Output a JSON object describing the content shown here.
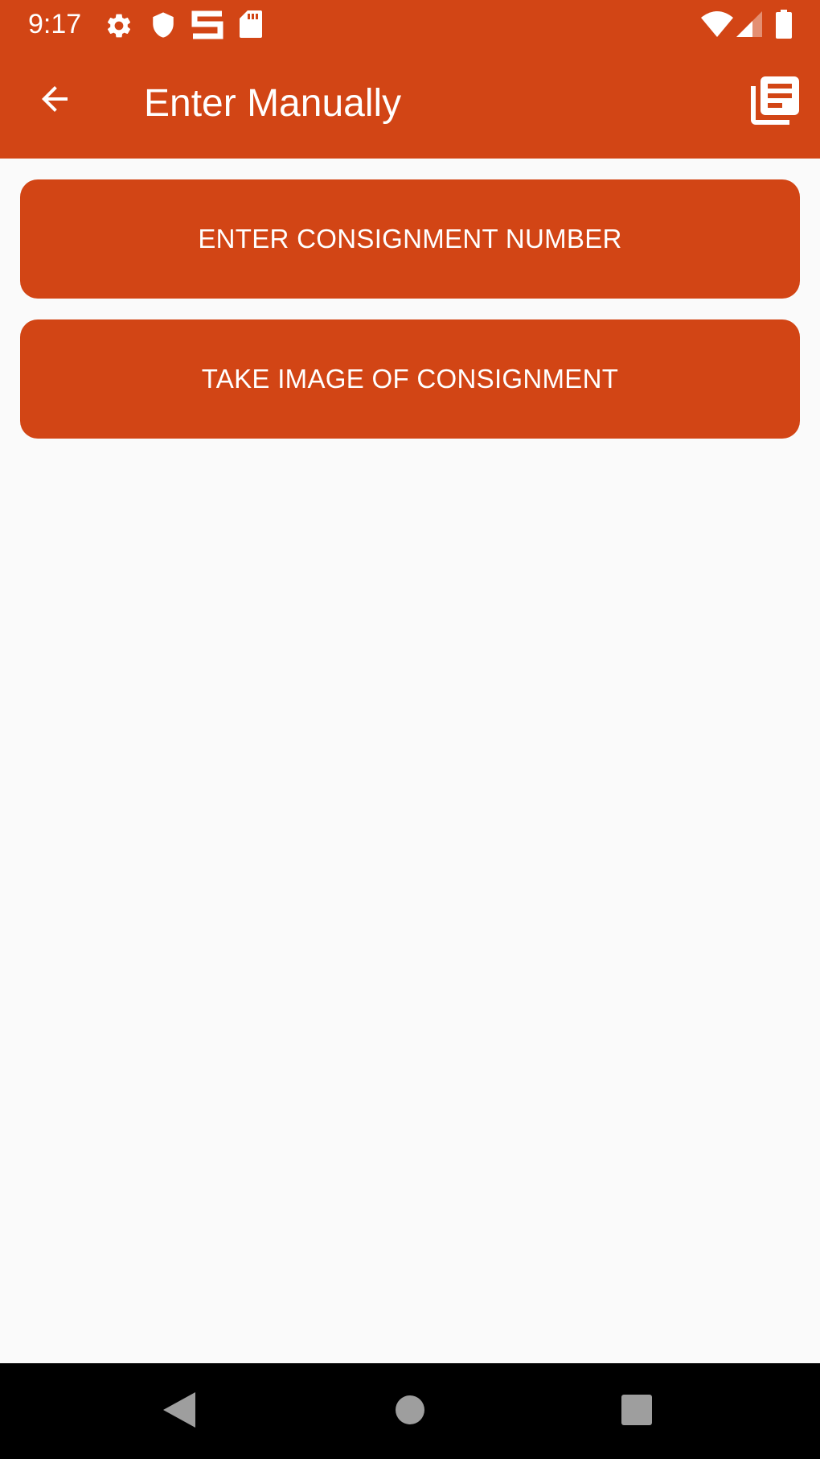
{
  "status_bar": {
    "time": "9:17",
    "left_icons": [
      "gear-icon",
      "shield-icon",
      "s-logo-icon",
      "sd-card-icon"
    ],
    "right_icons": [
      "wifi-icon",
      "cell-signal-icon",
      "battery-icon"
    ]
  },
  "app_bar": {
    "title": "Enter Manually",
    "back_icon": "arrow-back-icon",
    "action_icon": "library-books-icon"
  },
  "main": {
    "buttons": [
      {
        "label": "ENTER CONSIGNMENT NUMBER"
      },
      {
        "label": "TAKE IMAGE OF CONSIGNMENT"
      }
    ]
  },
  "nav_bar": {
    "icons": [
      "back-triangle-icon",
      "home-circle-icon",
      "recents-square-icon"
    ]
  },
  "colors": {
    "primary": "#d24515",
    "background": "#fafafa",
    "on_primary": "#ffffff",
    "nav_bar": "#000000",
    "nav_icons": "#9e9e9e"
  }
}
